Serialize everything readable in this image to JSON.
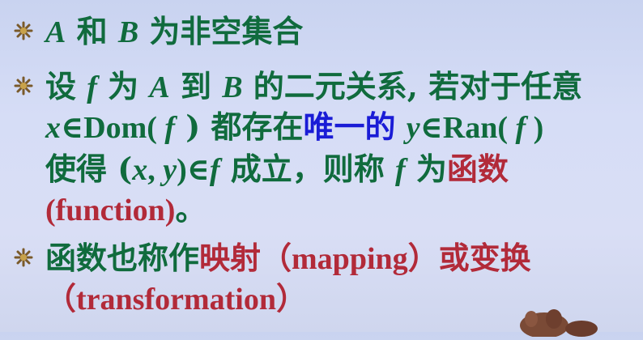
{
  "bullets": [
    {
      "icon": "asterisk-bullet-icon",
      "lines": [
        {
          "parts": [
            "A",
            " 和 ",
            "B",
            " 为非空集合"
          ]
        }
      ]
    },
    {
      "icon": "asterisk-bullet-icon",
      "lines": [
        {
          "parts": [
            "设 ",
            "f",
            " 为 ",
            "A",
            " 到 ",
            "B",
            " 的二元关系, 若对于任意"
          ]
        },
        {
          "parts": [
            "x",
            "∈Dom( ",
            "f",
            " ) 都存在",
            "唯一的",
            " ",
            "y",
            "∈Ran( ",
            "f",
            " )"
          ]
        },
        {
          "parts": [
            "使得 (",
            "x",
            ", ",
            "y",
            ")∈",
            "f",
            " 成立，则称 ",
            "f",
            " 为",
            "函数"
          ]
        },
        {
          "parts": [
            "(function)",
            "。"
          ]
        }
      ]
    },
    {
      "icon": "asterisk-bullet-icon",
      "lines": [
        {
          "parts": [
            "函数也称作",
            "映射",
            "（mapping）或",
            "变换"
          ]
        },
        {
          "parts": [
            "（transformation）"
          ]
        }
      ]
    }
  ],
  "colors": {
    "body_text": "#106b3d",
    "highlight_red": "#b22a39",
    "highlight_blue": "#1a1cd6",
    "background": "#d6ddf6"
  }
}
